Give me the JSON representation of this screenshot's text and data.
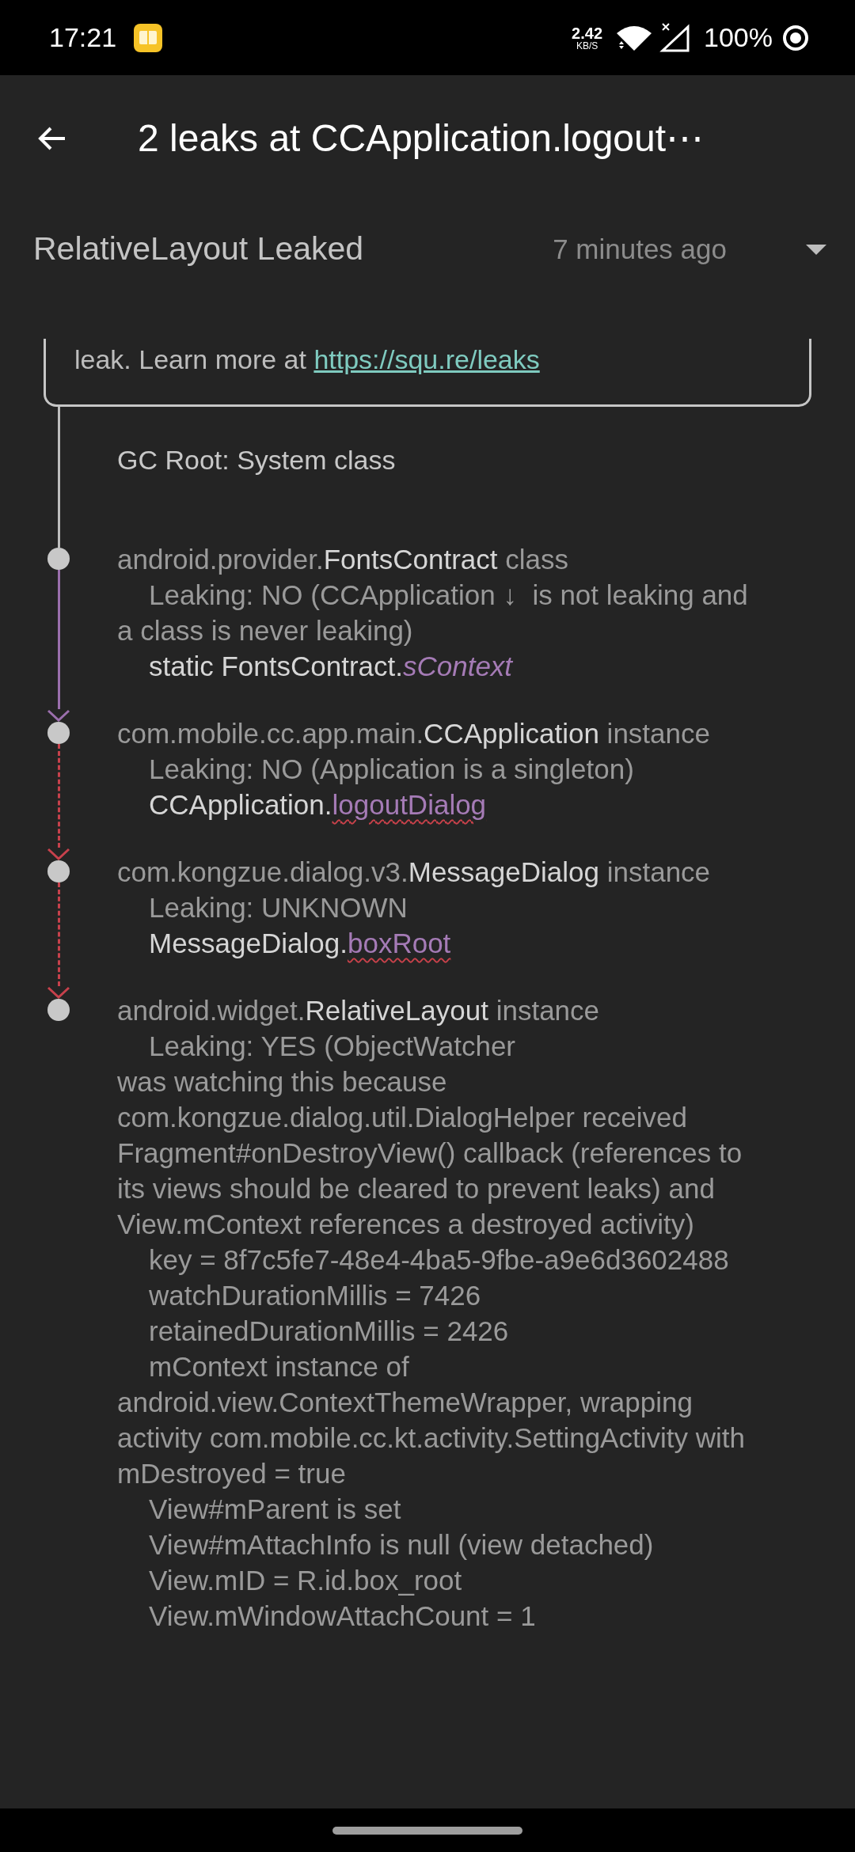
{
  "status_bar": {
    "time": "17:21",
    "net_speed": "2.42",
    "net_unit": "KB/S",
    "battery": "100%"
  },
  "app_bar": {
    "title": "2 leaks at CCApplication.logout⋯"
  },
  "leak_header": {
    "title": "RelativeLayout Leaked",
    "time": "7 minutes ago"
  },
  "info_card": {
    "text": "leak. Learn more at ",
    "link": "https://squ.re/leaks"
  },
  "gc_root": "GC Root: System class",
  "nodes": [
    {
      "package": "android.provider.",
      "class_name": "FontsContract",
      "suffix": " class",
      "details": [
        "Leaking: NO (CCApplication ↓  is not leaking and a class is never leaking)"
      ],
      "reference": {
        "owner": "static FontsContract.",
        "field": "sContext",
        "suspect": false
      },
      "kind": "static_field"
    },
    {
      "package": "com.mobile.cc.app.main.",
      "class_name": "CCApplication",
      "suffix": " instance",
      "details": [
        "Leaking: NO (Application is a singleton)"
      ],
      "reference": {
        "owner": "CCApplication.",
        "field": "logoutDialog",
        "suspect": true
      },
      "kind": "instance_field"
    },
    {
      "package": "com.kongzue.dialog.v3.",
      "class_name": "MessageDialog",
      "suffix": " instance",
      "details": [
        "Leaking: UNKNOWN"
      ],
      "reference": {
        "owner": "MessageDialog.",
        "field": "boxRoot",
        "suspect": true
      },
      "kind": "instance_field"
    },
    {
      "package": "android.widget.",
      "class_name": "RelativeLayout",
      "suffix": " instance",
      "details": [
        "Leaking: YES (ObjectWatcher\nwas watching this because com.kongzue.dialog.util.DialogHelper received Fragment#onDestroyView() callback (references to its views should be cleared to prevent leaks) and View.mContext references a destroyed activity)",
        "key = 8f7c5fe7-48e4-4ba5-9fbe-a9e6d3602488",
        "watchDurationMillis = 7426",
        "retainedDurationMillis = 2426",
        "mContext instance of android.view.ContextThemeWrapper, wrapping activity com.mobile.cc.kt.activity.SettingActivity with mDestroyed = true",
        "View#mParent is set",
        "View#mAttachInfo is null (view detached)",
        "View.mID = R.id.box_root",
        "View.mWindowAttachCount = 1"
      ],
      "kind": "leaking_object"
    }
  ]
}
